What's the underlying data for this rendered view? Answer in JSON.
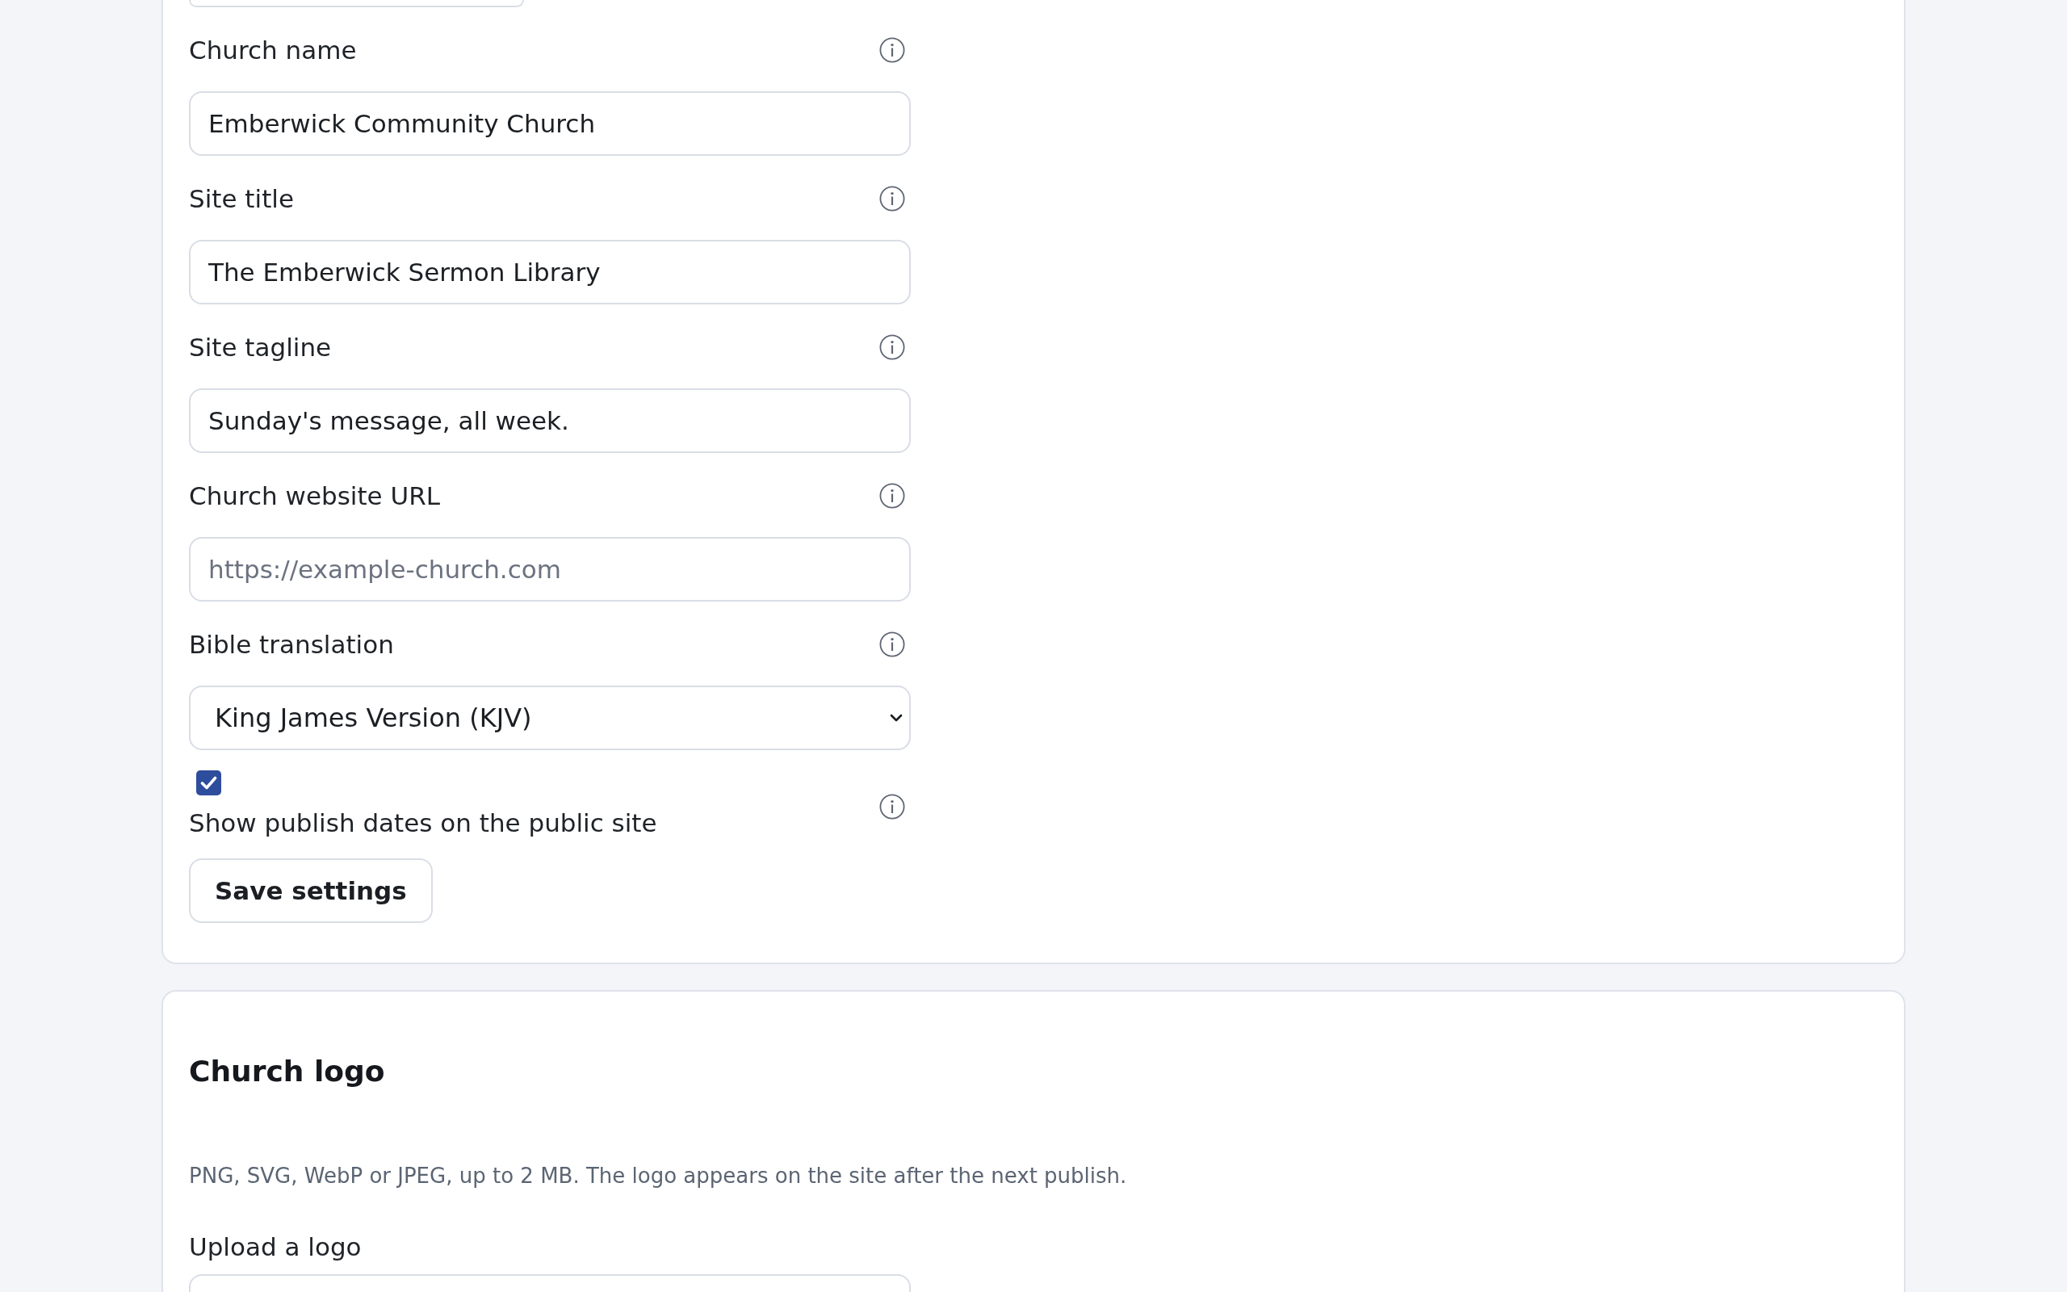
{
  "settings_card": {
    "fields": [
      {
        "kind": "text",
        "label": "Church name",
        "value": "Emberwick Community Church"
      },
      {
        "kind": "text",
        "label": "Site title",
        "value": "The Emberwick Sermon Library"
      },
      {
        "kind": "text",
        "label": "Site tagline",
        "value": "Sunday's message, all week."
      },
      {
        "kind": "text",
        "label": "Church website URL",
        "placeholder": "https://example-church.com"
      },
      {
        "kind": "select",
        "label": "Bible translation",
        "value": "King James Version (KJV)"
      },
      {
        "kind": "checkbox",
        "label": "Show publish dates on the public site",
        "checked": true
      }
    ],
    "save_button": "Save settings"
  },
  "logo_card": {
    "title": "Church logo",
    "description": "PNG, SVG, WebP or JPEG, up to 2 MB. The logo appears on the site after the next publish.",
    "upload_label": "Upload a logo"
  }
}
